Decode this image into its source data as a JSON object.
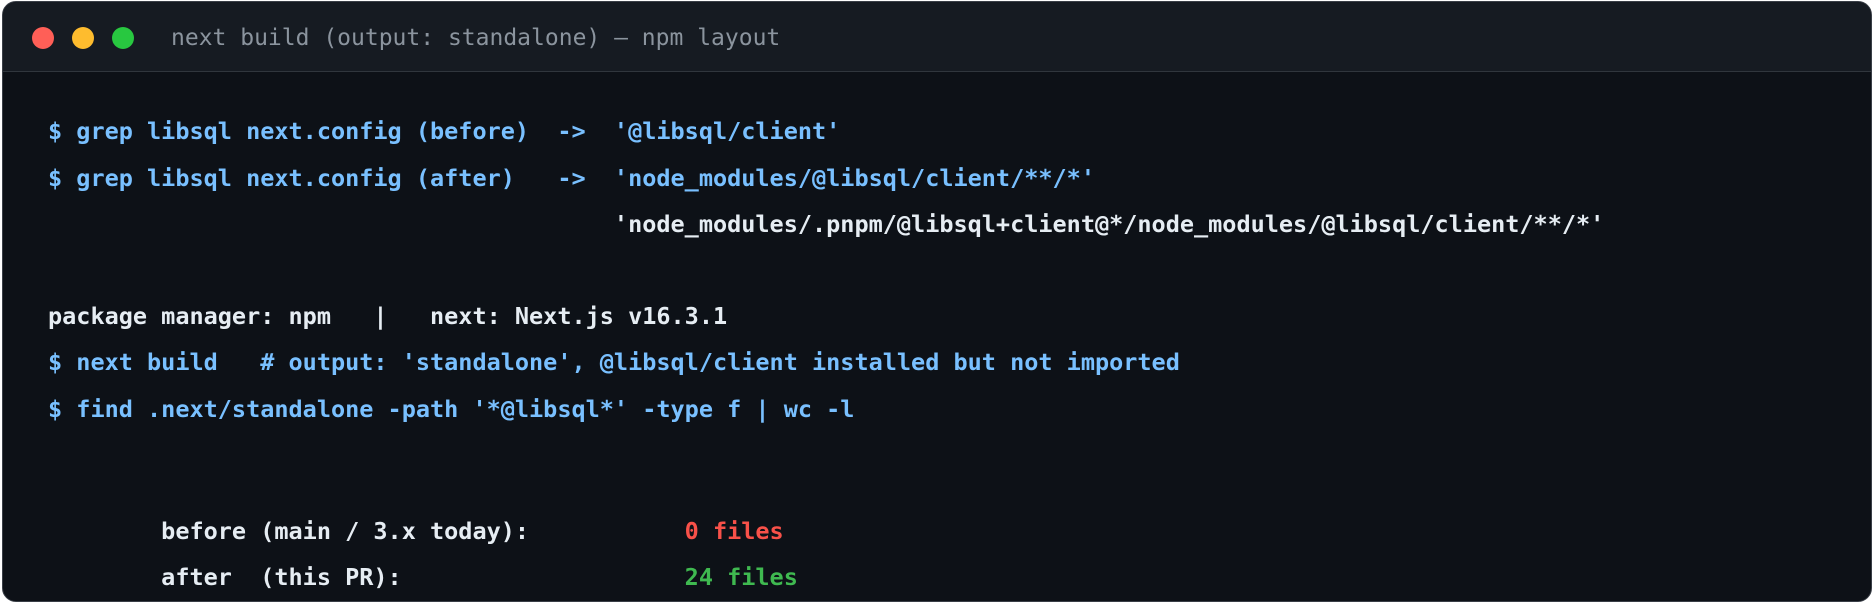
{
  "window": {
    "title": "next build (output: standalone) – npm layout"
  },
  "terminal": {
    "lines": [
      "$ grep libsql next.config (before)  ->  '@libsql/client'",
      "$ grep libsql next.config (after)   ->  'node_modules/@libsql/client/**/*'",
      "                                        'node_modules/.pnpm/@libsql+client@*/node_modules/@libsql/client/**/*'",
      "package manager: npm   |   next: Next.js v16.3.1",
      "$ next build   # output: 'standalone', @libsql/client installed but not imported",
      "$ find .next/standalone -path '*@libsql*' -type f | wc -l"
    ],
    "results": {
      "before_label": "  before (main / 3.x today):           ",
      "before_value": "0 files",
      "after_label": "  after  (this PR):                    ",
      "after_value": "24 files"
    }
  },
  "colors": {
    "command": "#79c0ff",
    "plain": "#e6edf3",
    "before_value": "#f85149",
    "after_value": "#3fb950"
  }
}
